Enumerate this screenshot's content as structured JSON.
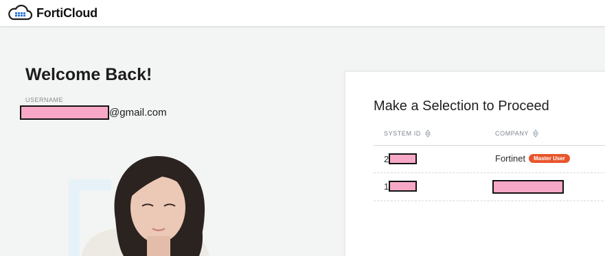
{
  "header": {
    "logo_icon": "cloud-grid-icon",
    "brand": "FortiCloud"
  },
  "welcome": {
    "title": "Welcome Back!",
    "username_label": "USERNAME",
    "username_suffix": "@gmail.com"
  },
  "selection": {
    "title": "Make a Selection to Proceed",
    "columns": {
      "system_id": "SYSTEM ID",
      "company": "COMPANY"
    },
    "rows": [
      {
        "system_id_prefix": "2",
        "company": "Fortinet",
        "badge": "Master User"
      },
      {
        "system_id_prefix": "1",
        "company": "",
        "badge": ""
      }
    ]
  },
  "colors": {
    "accent": "#1a6ed8",
    "badge": "#e8552a",
    "redaction": "#f7a8c6"
  }
}
